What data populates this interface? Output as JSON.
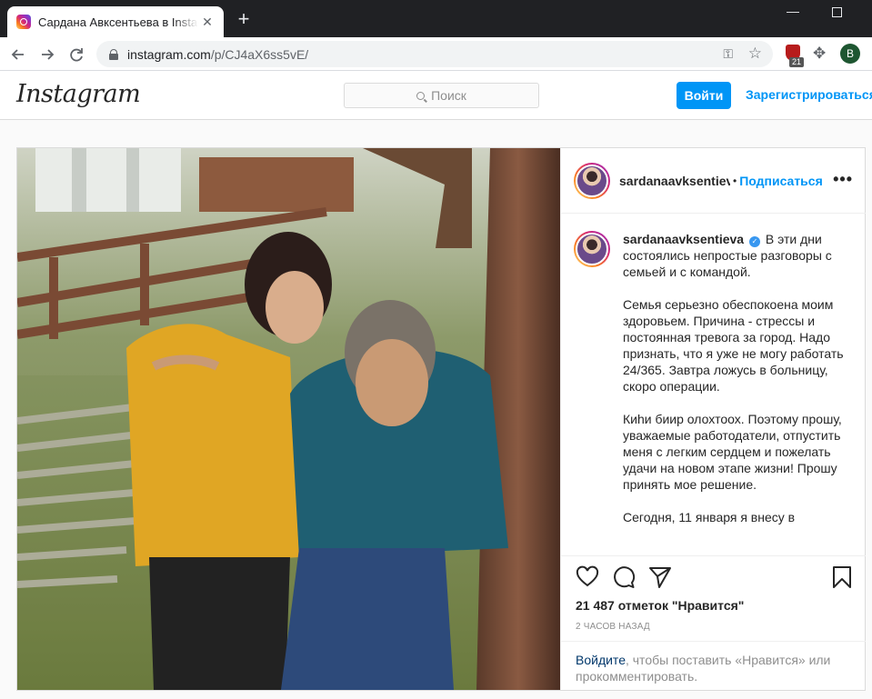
{
  "browser": {
    "tab_title": "Сардана Авксентьева в Instagram",
    "tab_close": "✕",
    "new_tab": "+",
    "url_domain": "instagram.com",
    "url_path": "/p/CJ4aX6ss5vE/",
    "extension_badge": "21",
    "profile_initial": "B",
    "window_minimize": "—"
  },
  "header": {
    "logo": "Instagram",
    "search_placeholder": "Поиск",
    "login_button": "Войти",
    "signup_link": "Зарегистрироваться"
  },
  "post": {
    "username": "sardanaavksentieva",
    "separator": "•",
    "follow_label": "Подписаться",
    "more_label": "•••",
    "caption_paragraphs": [
      "В эти дни состоялись непростые разговоры с семьей и с командой.",
      "Семья серьезно обеспокоена моим здоровьем. Причина - стрессы и постоянная тревога за город. Надо признать, что я уже не могу работать 24/365. Завтра ложусь в больницу, скоро операции.",
      "Киhи биир олохтоох. Поэтому прошу, уважаемые работодатели, отпустить меня с легким сердцем и пожелать удачи на новом этапе жизни! Прошу принять мое решение.",
      "Сегодня, 11 января я внесу в"
    ],
    "likes": "21 487 отметок \"Нравится\"",
    "time_ago": "2 ЧАСОВ НАЗАД",
    "login_prompt_link": "Войдите",
    "login_prompt_text": ", чтобы поставить «Нравится» или прокомментировать."
  },
  "icons": {
    "like": "heart-icon",
    "comment": "comment-icon",
    "share": "send-icon",
    "save": "bookmark-icon",
    "verified": "verified-badge-icon"
  },
  "colors": {
    "brand_blue": "#0095f6",
    "link_dark": "#00376b",
    "chrome_dark": "#202124"
  }
}
